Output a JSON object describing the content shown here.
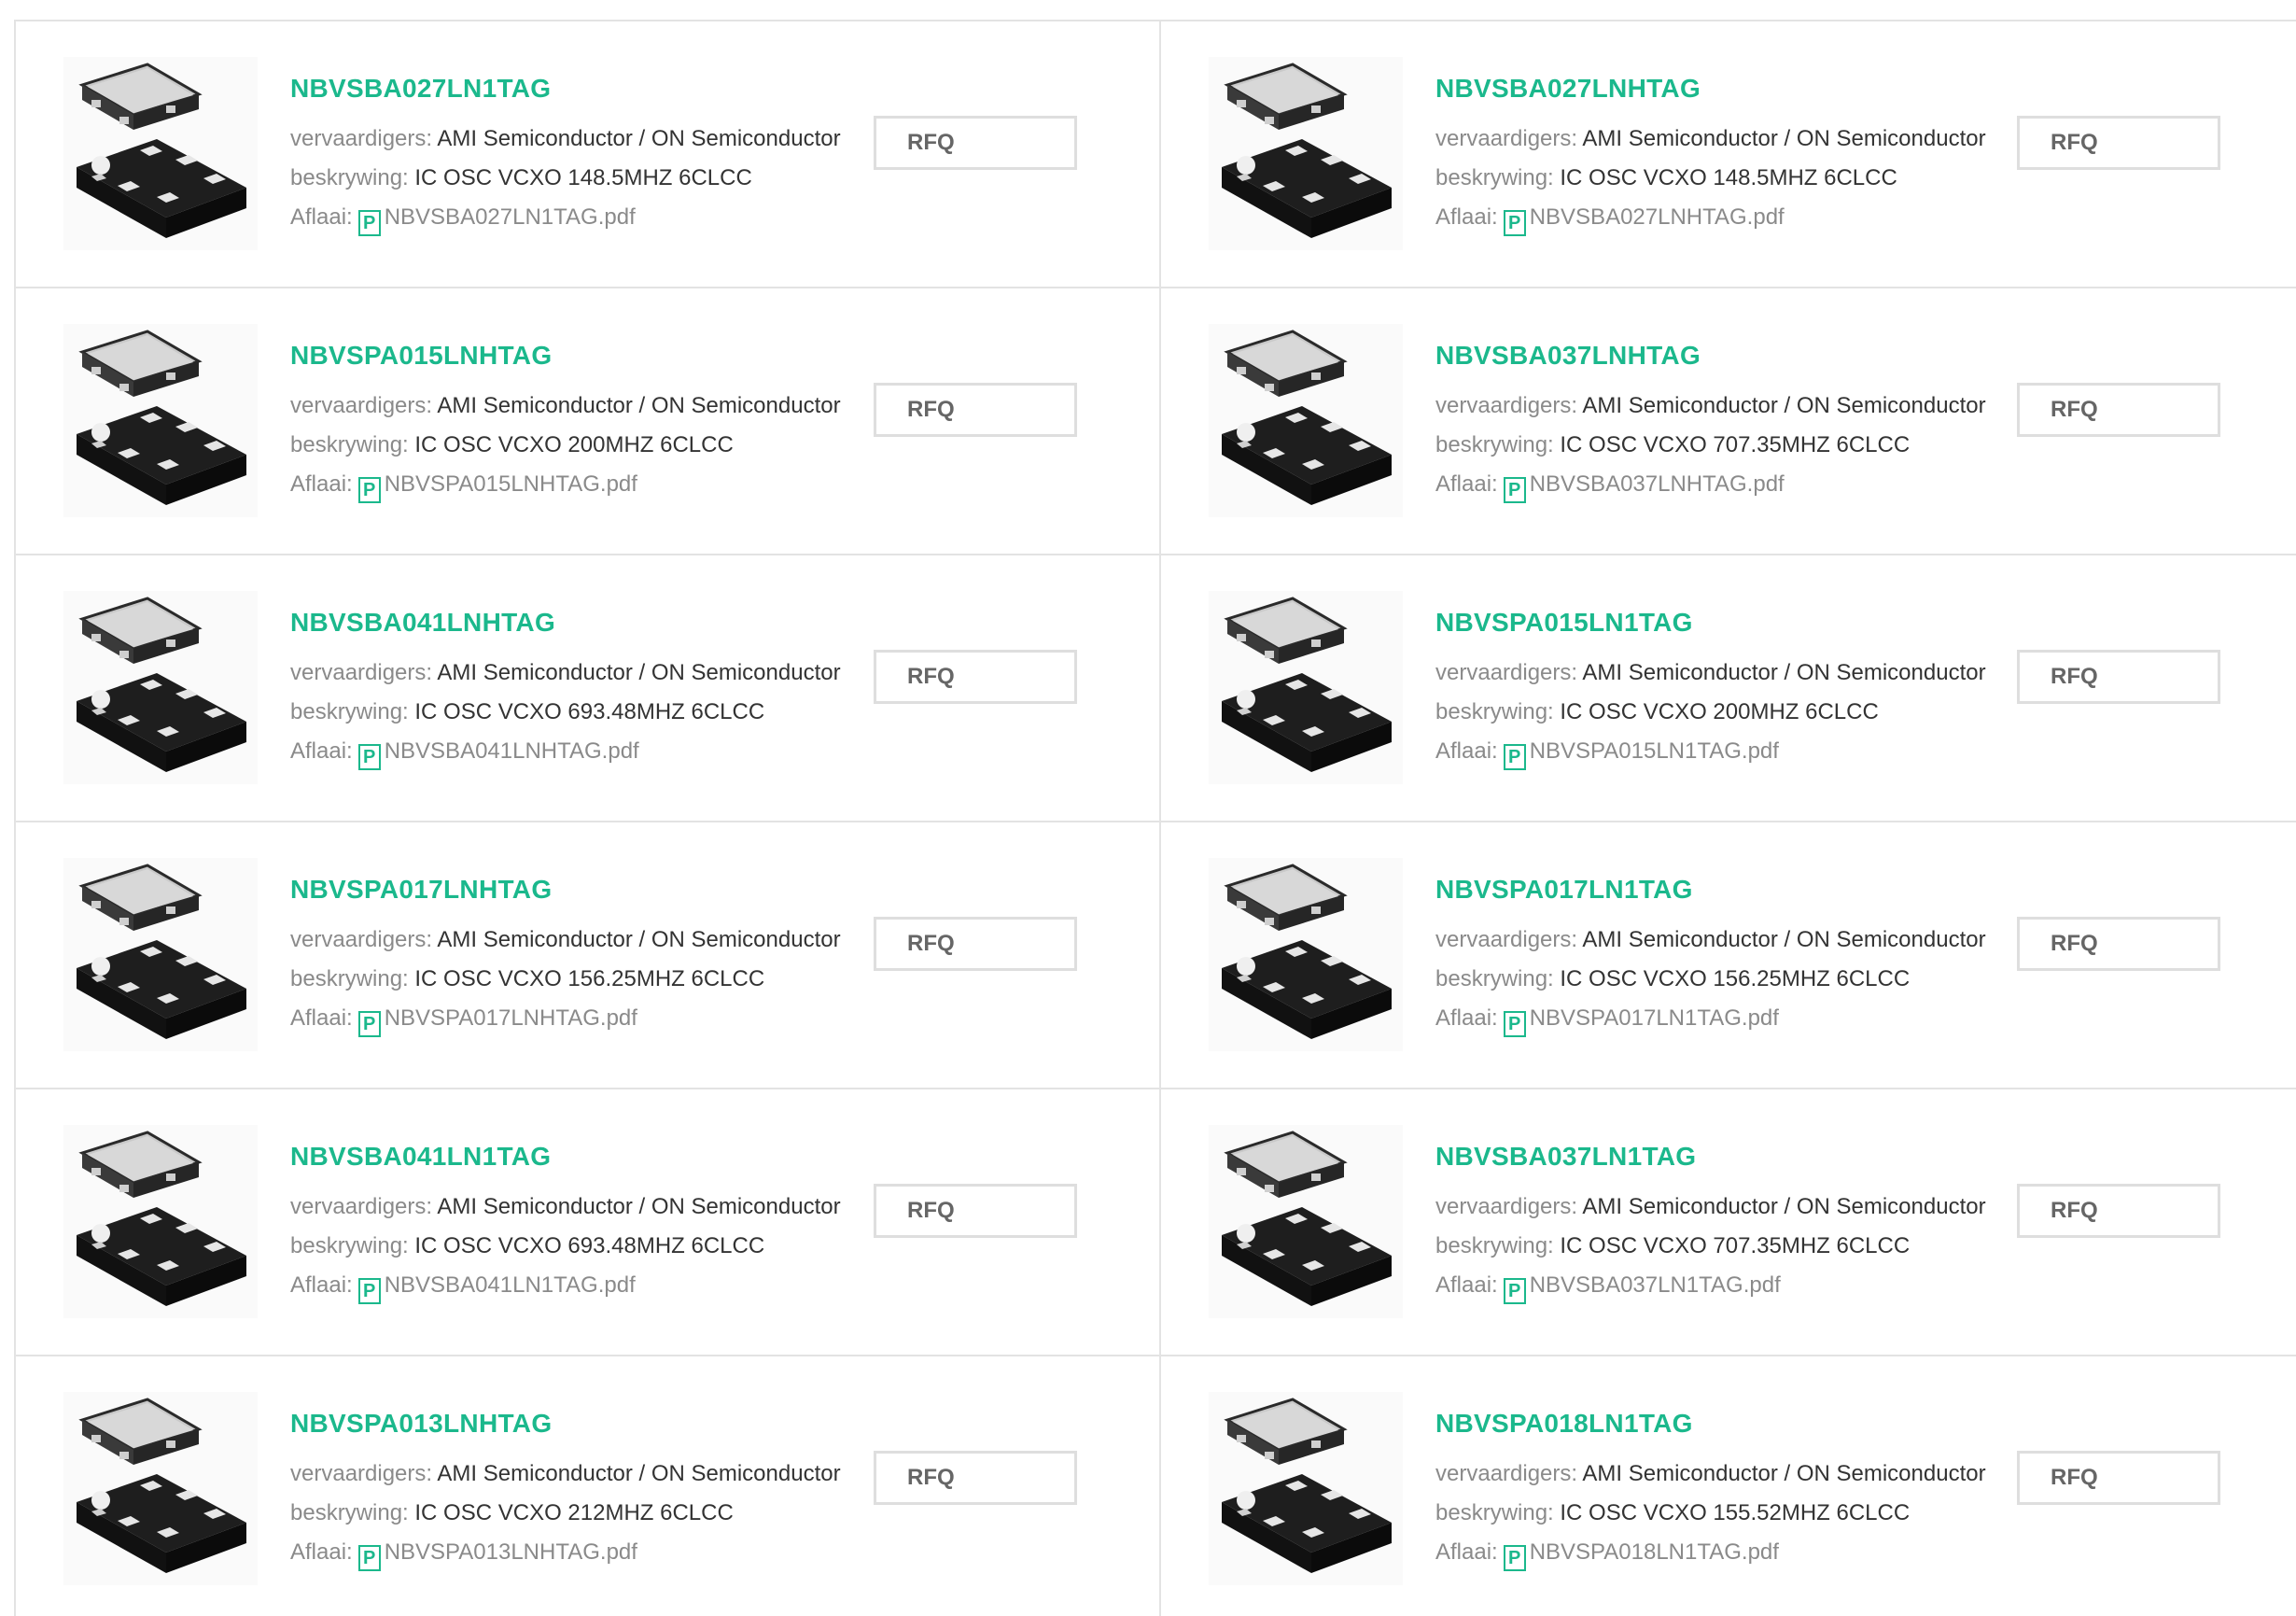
{
  "labels": {
    "manufacturer": "vervaardigers:",
    "description": "beskrywing:",
    "download": "Aflaai:",
    "rfq": "RFQ",
    "pdf_icon_glyph": "P"
  },
  "colors": {
    "accent": "#1bb88c",
    "label_gray": "#8a8a8a",
    "border": "#e3e3e3"
  },
  "products": [
    {
      "part": "NBVSBA027LN1TAG",
      "manufacturer": "AMI Semiconductor / ON Semiconductor",
      "description": "IC OSC VCXO 148.5MHZ 6CLCC",
      "pdf": "NBVSBA027LN1TAG.pdf"
    },
    {
      "part": "NBVSBA027LNHTAG",
      "manufacturer": "AMI Semiconductor / ON Semiconductor",
      "description": "IC OSC VCXO 148.5MHZ 6CLCC",
      "pdf": "NBVSBA027LNHTAG.pdf"
    },
    {
      "part": "NBVSPA015LNHTAG",
      "manufacturer": "AMI Semiconductor / ON Semiconductor",
      "description": "IC OSC VCXO 200MHZ 6CLCC",
      "pdf": "NBVSPA015LNHTAG.pdf"
    },
    {
      "part": "NBVSBA037LNHTAG",
      "manufacturer": "AMI Semiconductor / ON Semiconductor",
      "description": "IC OSC VCXO 707.35MHZ 6CLCC",
      "pdf": "NBVSBA037LNHTAG.pdf"
    },
    {
      "part": "NBVSBA041LNHTAG",
      "manufacturer": "AMI Semiconductor / ON Semiconductor",
      "description": "IC OSC VCXO 693.48MHZ 6CLCC",
      "pdf": "NBVSBA041LNHTAG.pdf"
    },
    {
      "part": "NBVSPA015LN1TAG",
      "manufacturer": "AMI Semiconductor / ON Semiconductor",
      "description": "IC OSC VCXO 200MHZ 6CLCC",
      "pdf": "NBVSPA015LN1TAG.pdf"
    },
    {
      "part": "NBVSPA017LNHTAG",
      "manufacturer": "AMI Semiconductor / ON Semiconductor",
      "description": "IC OSC VCXO 156.25MHZ 6CLCC",
      "pdf": "NBVSPA017LNHTAG.pdf"
    },
    {
      "part": "NBVSPA017LN1TAG",
      "manufacturer": "AMI Semiconductor / ON Semiconductor",
      "description": "IC OSC VCXO 156.25MHZ 6CLCC",
      "pdf": "NBVSPA017LN1TAG.pdf"
    },
    {
      "part": "NBVSBA041LN1TAG",
      "manufacturer": "AMI Semiconductor / ON Semiconductor",
      "description": "IC OSC VCXO 693.48MHZ 6CLCC",
      "pdf": "NBVSBA041LN1TAG.pdf"
    },
    {
      "part": "NBVSBA037LN1TAG",
      "manufacturer": "AMI Semiconductor / ON Semiconductor",
      "description": "IC OSC VCXO 707.35MHZ 6CLCC",
      "pdf": "NBVSBA037LN1TAG.pdf"
    },
    {
      "part": "NBVSPA013LNHTAG",
      "manufacturer": "AMI Semiconductor / ON Semiconductor",
      "description": "IC OSC VCXO 212MHZ 6CLCC",
      "pdf": "NBVSPA013LNHTAG.pdf"
    },
    {
      "part": "NBVSPA018LN1TAG",
      "manufacturer": "AMI Semiconductor / ON Semiconductor",
      "description": "IC OSC VCXO 155.52MHZ 6CLCC",
      "pdf": "NBVSPA018LN1TAG.pdf"
    }
  ]
}
